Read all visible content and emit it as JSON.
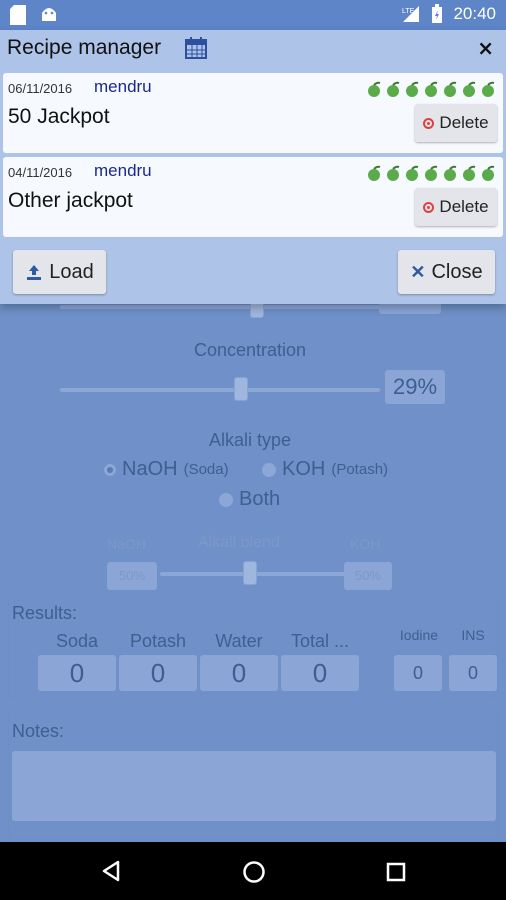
{
  "status_bar": {
    "time": "20:40",
    "signal_label": "LTE",
    "icons": [
      "sd-card-icon",
      "android-icon",
      "signal-icon",
      "battery-icon"
    ]
  },
  "background": {
    "concentration_label": "Concentration",
    "concentration_value": "29%",
    "alkali_type_label": "Alkali type",
    "alkali_options": [
      {
        "main": "NaOH",
        "sub": "(Soda)",
        "selected": true
      },
      {
        "main": "KOH",
        "sub": "(Potash)",
        "selected": false
      },
      {
        "main": "Both",
        "sub": "",
        "selected": false
      }
    ],
    "blend": {
      "left_label": "NaOH",
      "center_label": "Alkali blend",
      "right_label": "KOH",
      "left_value": "50%",
      "right_value": "50%"
    },
    "results": {
      "label": "Results:",
      "columns": [
        {
          "header": "Soda",
          "value": "0"
        },
        {
          "header": "Potash",
          "value": "0"
        },
        {
          "header": "Water",
          "value": "0"
        },
        {
          "header": "Total ...",
          "value": "0"
        }
      ],
      "extra": [
        {
          "header": "Iodine",
          "value": "0"
        },
        {
          "header": "INS",
          "value": "0"
        }
      ]
    },
    "notes_label": "Notes:"
  },
  "dialog": {
    "title": "Recipe manager",
    "close_symbol": "×",
    "recipes": [
      {
        "date": "06/11/2016",
        "user": "mendru",
        "name": "50 Jackpot",
        "delete_label": "Delete"
      },
      {
        "date": "04/11/2016",
        "user": "mendru",
        "name": "Other jackpot",
        "delete_label": "Delete"
      }
    ],
    "load_label": "Load",
    "close_label": "Close"
  },
  "colors": {
    "accent": "#adc3e8",
    "card": "#f6fafe",
    "user_text": "#1a2a8a",
    "star": "#5cab4a"
  }
}
